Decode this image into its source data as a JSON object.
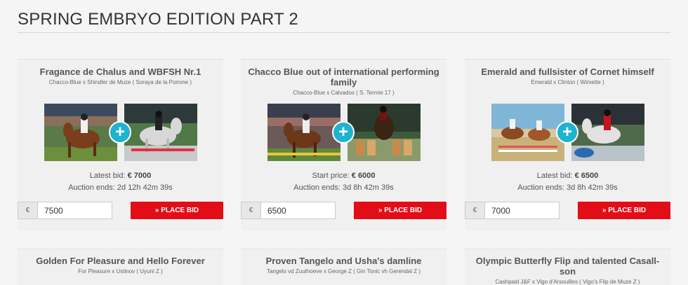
{
  "page": {
    "title": "SPRING EMBRYO EDITION PART 2"
  },
  "cards": [
    {
      "title": "Fragance de Chalus and WBFSH Nr.1",
      "subtitle": "Chacco-Blue x Shindler de Muze ( Soraya de la Pomme )",
      "price_label": "Latest bid:",
      "price_value": "€ 7000",
      "auction_ends": "Auction ends: 2d 12h 42m 39s",
      "currency": "€",
      "bid_amount": "7500",
      "bid_button": "» PLACE BID"
    },
    {
      "title": "Chacco Blue out of international performing family",
      "subtitle": "Chacco-Blue x Calvados ( S. Termie 17 )",
      "price_label": "Start price:",
      "price_value": "€ 6000",
      "auction_ends": "Auction ends: 3d 8h 42m 39s",
      "currency": "€",
      "bid_amount": "6500",
      "bid_button": "» PLACE BID"
    },
    {
      "title": "Emerald and fullsister of Cornet himself",
      "subtitle": "Emerald x Clinton ( Wimette )",
      "price_label": "Latest bid:",
      "price_value": "€ 6500",
      "auction_ends": "Auction ends: 3d 8h 42m 39s",
      "currency": "€",
      "bid_amount": "7000",
      "bid_button": "» PLACE BID"
    },
    {
      "title": "Golden For Pleasure and Hello Forever",
      "subtitle": "For Pleasure x Ustinov ( Uyuni Z )"
    },
    {
      "title": "Proven Tangelo and Usha's damline",
      "subtitle": "Tangelo vd Zuuthoeve x George Z ( Gin Tonic vh Gerendal Z )"
    },
    {
      "title": "Olympic Butterfly Flip and talented Casall-son",
      "subtitle": "Cashpaid J&F x Vigo d'Arsouilles ( Vigo's Flip de Muze Z )"
    }
  ],
  "icons": {
    "expand": "plus-icon"
  },
  "colors": {
    "accent": "#1fb3cf",
    "bid_button": "#e30d18"
  }
}
